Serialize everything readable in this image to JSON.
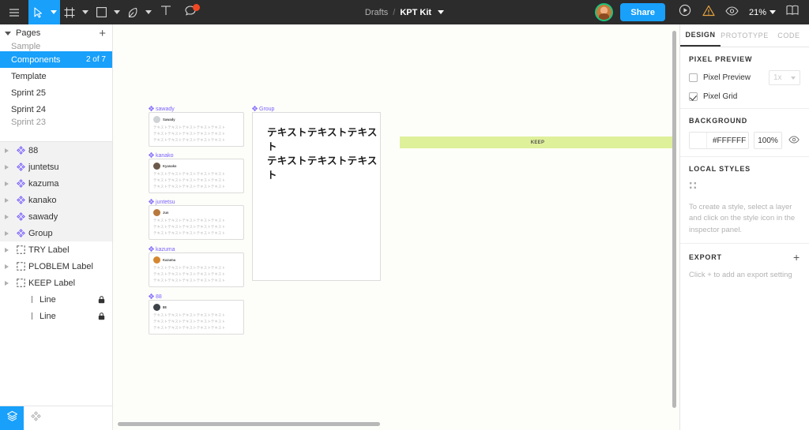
{
  "toolbar": {
    "menu_icon": "hamburger-menu-icon",
    "tools": [
      {
        "icon": "move-cursor-icon",
        "active": true
      },
      {
        "icon": "frame-icon",
        "active": false
      },
      {
        "icon": "rectangle-shape-icon",
        "active": false
      },
      {
        "icon": "pen-tool-icon",
        "active": false
      }
    ],
    "text_tool_icon": "text-tool-icon",
    "comment_icon": "comment-icon",
    "breadcrumb": {
      "project": "Drafts",
      "separator": "/",
      "file": "KPT Kit"
    },
    "share_label": "Share",
    "present_icon": "play-present-icon",
    "warning_icon": "warning-triangle-icon",
    "visibility_icon": "eye-icon",
    "zoom_level": "21%",
    "library_icon": "book-library-icon"
  },
  "left_panel": {
    "pages_header": "Pages",
    "add_page_label": "+",
    "pages": [
      {
        "label": "Sample",
        "count": "",
        "selected": false,
        "partial": true
      },
      {
        "label": "Components",
        "count": "2 of 7",
        "selected": true,
        "partial": false
      },
      {
        "label": "Template",
        "count": "",
        "selected": false,
        "partial": false
      },
      {
        "label": "Sprint 25",
        "count": "",
        "selected": false,
        "partial": false
      },
      {
        "label": "Sprint 24",
        "count": "",
        "selected": false,
        "partial": false
      },
      {
        "label": "Sprint 23",
        "count": "",
        "selected": false,
        "partial": true
      }
    ],
    "layers": [
      {
        "label": "88",
        "icon": "component-icon",
        "group": true,
        "locked": false,
        "indent": false
      },
      {
        "label": "juntetsu",
        "icon": "component-icon",
        "group": true,
        "locked": false,
        "indent": false
      },
      {
        "label": "kazuma",
        "icon": "component-icon",
        "group": true,
        "locked": false,
        "indent": false
      },
      {
        "label": "kanako",
        "icon": "component-icon",
        "group": true,
        "locked": false,
        "indent": false
      },
      {
        "label": "sawady",
        "icon": "component-icon",
        "group": true,
        "locked": false,
        "indent": false
      },
      {
        "label": "Group",
        "icon": "component-icon",
        "group": true,
        "locked": false,
        "indent": false
      },
      {
        "label": "TRY Label",
        "icon": "frame-dashed-icon",
        "group": false,
        "locked": false,
        "indent": false
      },
      {
        "label": "PLOBLEM Label",
        "icon": "frame-dashed-icon",
        "group": false,
        "locked": false,
        "indent": false
      },
      {
        "label": "KEEP Label",
        "icon": "frame-dashed-icon",
        "group": false,
        "locked": false,
        "indent": false
      },
      {
        "label": "Line",
        "icon": "line-icon",
        "group": false,
        "locked": true,
        "indent": true
      },
      {
        "label": "Line",
        "icon": "line-icon",
        "group": false,
        "locked": true,
        "indent": true
      }
    ],
    "bottom_bar": {
      "layers_tab_icon": "layers-icon",
      "assets_tab_icon": "component-assets-icon"
    }
  },
  "canvas": {
    "cards": [
      {
        "label": "sawady",
        "avatar_name": "Sawady",
        "avatar_color": "#cfd3d6",
        "lines": [
          "テキストテキストテキストテキストテキスト",
          "テキストテキストテキストテキストテキスト",
          "テキストテキストテキストテキストテキスト"
        ]
      },
      {
        "label": "kanako",
        "avatar_name": "Kyanako",
        "avatar_color": "#6b5a4b",
        "lines": [
          "テキストテキストテキストテキストテキスト",
          "テキストテキストテキストテキストテキスト",
          "テキストテキストテキストテキストテキスト"
        ]
      },
      {
        "label": "juntetsu",
        "avatar_name": "Jun",
        "avatar_color": "#b8793c",
        "lines": [
          "テキストテキストテキストテキストテキスト",
          "テキストテキストテキストテキストテキスト",
          "テキストテキストテキストテキストテキスト"
        ]
      },
      {
        "label": "kazuma",
        "avatar_name": "Kazuma",
        "avatar_color": "#d4872f",
        "lines": [
          "テキストテキストテキストテキストテキスト",
          "テキストテキストテキストテキストテキスト",
          "テキストテキストテキストテキストテキスト"
        ]
      },
      {
        "label": "88",
        "avatar_name": "88",
        "avatar_color": "#3d4348",
        "lines": [
          "テキストテキストテキストテキストテキスト",
          "テキストテキストテキストテキストテキスト",
          "テキストテキストテキストテキストテキスト"
        ]
      }
    ],
    "group": {
      "label": "Group",
      "line1": "テキストテキストテキスト",
      "line2": "テキストテキストテキスト"
    },
    "keep_band": {
      "text": "KEEP",
      "color": "#dff09a"
    }
  },
  "right_panel": {
    "tabs": [
      {
        "label": "DESIGN",
        "active": true
      },
      {
        "label": "PROTOTYPE",
        "active": false
      },
      {
        "label": "CODE",
        "active": false
      }
    ],
    "pixel_preview": {
      "heading": "PIXEL PREVIEW",
      "preview_label": "Pixel Preview",
      "preview_checked": false,
      "scale_value": "1x",
      "grid_label": "Pixel Grid",
      "grid_checked": true
    },
    "background": {
      "heading": "BACKGROUND",
      "hex": "#FFFFFF",
      "opacity": "100%",
      "visibility_icon": "eye-icon"
    },
    "local_styles": {
      "heading": "LOCAL STYLES",
      "style_icon": "four-dot-style-icon",
      "hint": "To create a style, select a layer and click on the style icon in the inspector panel."
    },
    "export": {
      "heading": "EXPORT",
      "add_label": "+",
      "hint": "Click + to add an export setting"
    }
  }
}
